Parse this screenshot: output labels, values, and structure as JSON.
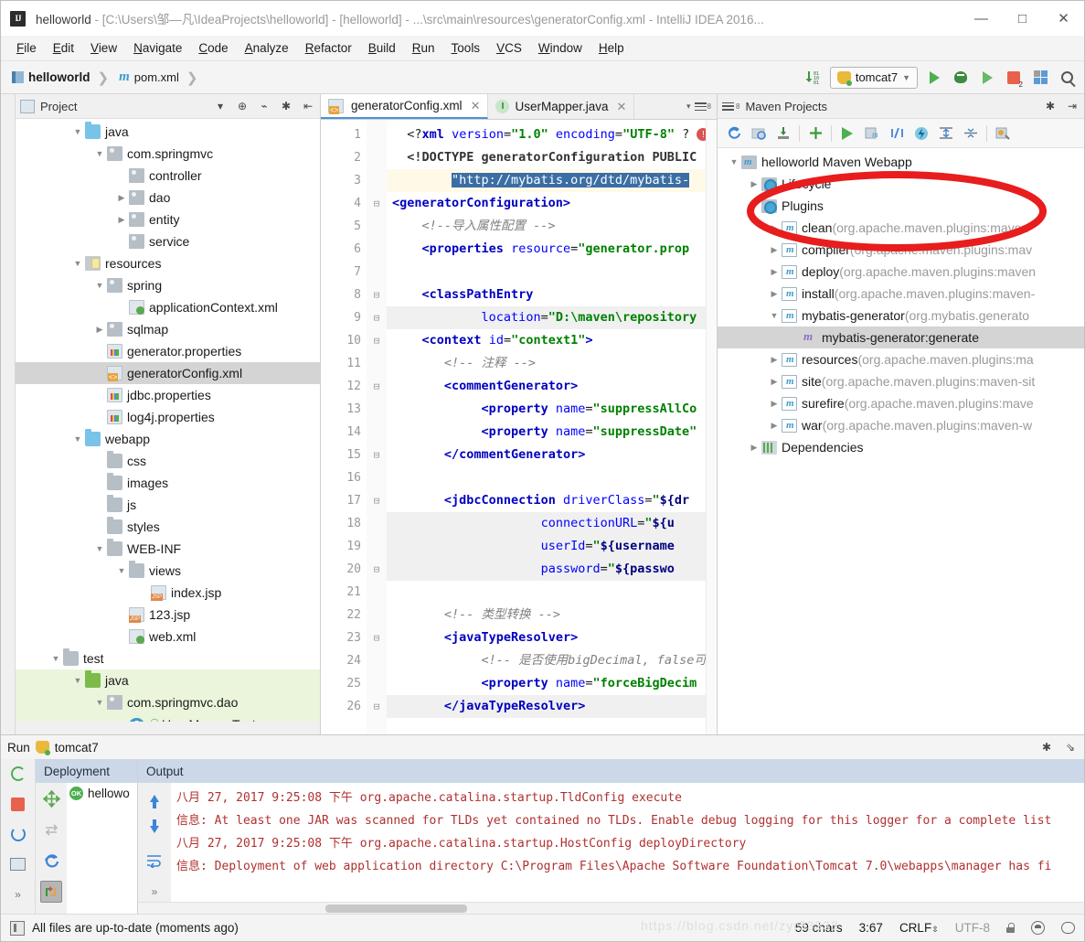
{
  "window": {
    "title_project": "helloworld",
    "title_rest": " - [C:\\Users\\邹—凡\\IdeaProjects\\helloworld] - [helloworld] - ...\\src\\main\\resources\\generatorConfig.xml - IntelliJ IDEA 2016...",
    "minimize": "—",
    "maximize": "□",
    "close": "✕"
  },
  "menubar": {
    "items": [
      "File",
      "Edit",
      "View",
      "Navigate",
      "Code",
      "Analyze",
      "Refactor",
      "Build",
      "Run",
      "Tools",
      "VCS",
      "Window",
      "Help"
    ]
  },
  "navbar": {
    "breadcrumb": [
      "helloworld",
      "pom.xml"
    ],
    "run_config": "tomcat7",
    "stop_badge": "2"
  },
  "project_panel": {
    "title": "Project",
    "tree": [
      {
        "label": "java",
        "indent": 2,
        "arrow": "down",
        "icon": "folder-source-blue"
      },
      {
        "label": "com.springmvc",
        "indent": 3,
        "arrow": "down",
        "icon": "package"
      },
      {
        "label": "controller",
        "indent": 4,
        "arrow": "none",
        "icon": "package"
      },
      {
        "label": "dao",
        "indent": 4,
        "arrow": "right",
        "icon": "package"
      },
      {
        "label": "entity",
        "indent": 4,
        "arrow": "right",
        "icon": "package"
      },
      {
        "label": "service",
        "indent": 4,
        "arrow": "none",
        "icon": "package"
      },
      {
        "label": "resources",
        "indent": 2,
        "arrow": "down",
        "icon": "folder-resource"
      },
      {
        "label": "spring",
        "indent": 3,
        "arrow": "down",
        "icon": "package"
      },
      {
        "label": "applicationContext.xml",
        "indent": 4,
        "arrow": "none",
        "icon": "xml-spring"
      },
      {
        "label": "sqlmap",
        "indent": 3,
        "arrow": "right",
        "icon": "package"
      },
      {
        "label": "generator.properties",
        "indent": 3,
        "arrow": "none",
        "icon": "properties"
      },
      {
        "label": "generatorConfig.xml",
        "indent": 3,
        "arrow": "none",
        "icon": "xml",
        "selected": true
      },
      {
        "label": "jdbc.properties",
        "indent": 3,
        "arrow": "none",
        "icon": "properties"
      },
      {
        "label": "log4j.properties",
        "indent": 3,
        "arrow": "none",
        "icon": "properties"
      },
      {
        "label": "webapp",
        "indent": 2,
        "arrow": "down",
        "icon": "folder-webapp"
      },
      {
        "label": "css",
        "indent": 3,
        "arrow": "none",
        "icon": "folder-gray"
      },
      {
        "label": "images",
        "indent": 3,
        "arrow": "none",
        "icon": "folder-gray"
      },
      {
        "label": "js",
        "indent": 3,
        "arrow": "none",
        "icon": "folder-gray"
      },
      {
        "label": "styles",
        "indent": 3,
        "arrow": "none",
        "icon": "folder-gray"
      },
      {
        "label": "WEB-INF",
        "indent": 3,
        "arrow": "down",
        "icon": "folder-gray"
      },
      {
        "label": "views",
        "indent": 4,
        "arrow": "down",
        "icon": "folder-gray"
      },
      {
        "label": "index.jsp",
        "indent": 5,
        "arrow": "none",
        "icon": "jsp"
      },
      {
        "label": "123.jsp",
        "indent": 4,
        "arrow": "none",
        "icon": "jsp"
      },
      {
        "label": "web.xml",
        "indent": 4,
        "arrow": "none",
        "icon": "xml-spring"
      },
      {
        "label": "test",
        "indent": 1,
        "arrow": "down",
        "icon": "folder-gray"
      },
      {
        "label": "java",
        "indent": 2,
        "arrow": "down",
        "icon": "folder-test-green",
        "test": true
      },
      {
        "label": "com.springmvc.dao",
        "indent": 3,
        "arrow": "down",
        "icon": "package",
        "test": true
      },
      {
        "label": "UserMapperTest",
        "indent": 4,
        "arrow": "none",
        "icon": "class",
        "test": true,
        "lock": true
      }
    ]
  },
  "editor": {
    "tabs": [
      {
        "label": "generatorConfig.xml",
        "icon": "xml-file-icon",
        "active": true,
        "close": "✕"
      },
      {
        "label": "UserMapper.java",
        "icon": "java-interface-icon",
        "active": false,
        "close": "✕"
      }
    ],
    "line_count_badge": "8",
    "lines": [
      {
        "n": 1,
        "fold": "",
        "state": "",
        "html": "  <span class='k-plain'>&lt;?</span><span class='k-tag'>xml</span> <span class='k-attr'>version</span>=<span class='k-str'>\"1.0\"</span> <span class='k-attr'>encoding</span>=<span class='k-str'>\"UTF-8\"</span> <span class='k-plain'>?</span>"
      },
      {
        "n": 2,
        "fold": "",
        "state": "",
        "html": "  <span class='k-dtd'>&lt;!DOCTYPE generatorConfiguration PUBLIC</span>"
      },
      {
        "n": 3,
        "fold": "",
        "state": "cur",
        "html": "        <span class='sel-blue'>\"http://mybatis.org/dtd/mybatis-</span>"
      },
      {
        "n": 4,
        "fold": "-",
        "state": "",
        "html": "<span class='k-tag'>&lt;generatorConfiguration&gt;</span>"
      },
      {
        "n": 5,
        "fold": "",
        "state": "",
        "html": "    <span class='k-cmt'>&lt;!--导入属性配置 --&gt;</span>"
      },
      {
        "n": 6,
        "fold": "",
        "state": "",
        "html": "    <span class='k-tag'>&lt;properties</span> <span class='k-attr'>resource</span>=<span class='k-str'>\"generator.prop</span>"
      },
      {
        "n": 7,
        "fold": "",
        "state": "",
        "html": ""
      },
      {
        "n": 8,
        "fold": "-",
        "state": "",
        "html": "    <span class='k-tag'>&lt;classPathEntry</span>"
      },
      {
        "n": 9,
        "fold": "-",
        "state": "hl",
        "html": "            <span class='k-attr'>location</span>=<span class='k-str'>\"D:\\maven\\repository</span>"
      },
      {
        "n": 10,
        "fold": "-",
        "state": "",
        "html": "    <span class='k-tag'>&lt;context</span> <span class='k-attr'>id</span>=<span class='k-str'>\"context1\"</span><span class='k-tag'>&gt;</span>"
      },
      {
        "n": 11,
        "fold": "",
        "state": "",
        "html": "       <span class='k-cmt'>&lt;!-- 注释 --&gt;</span>"
      },
      {
        "n": 12,
        "fold": "-",
        "state": "",
        "html": "       <span class='k-tag'>&lt;commentGenerator&gt;</span>"
      },
      {
        "n": 13,
        "fold": "",
        "state": "",
        "html": "            <span class='k-tag'>&lt;property</span> <span class='k-attr'>name</span>=<span class='k-str'>\"suppressAllCo</span>"
      },
      {
        "n": 14,
        "fold": "",
        "state": "",
        "html": "            <span class='k-tag'>&lt;property</span> <span class='k-attr'>name</span>=<span class='k-str'>\"suppressDate\"</span>"
      },
      {
        "n": 15,
        "fold": "-",
        "state": "",
        "html": "       <span class='k-tag'>&lt;/commentGenerator&gt;</span>"
      },
      {
        "n": 16,
        "fold": "",
        "state": "",
        "html": ""
      },
      {
        "n": 17,
        "fold": "-",
        "state": "",
        "html": "       <span class='k-tag'>&lt;jdbcConnection</span> <span class='k-attr'>driverClass</span>=<span class='k-str'>\"</span><span class='k-var'>${dr</span>"
      },
      {
        "n": 18,
        "fold": "",
        "state": "hl",
        "html": "                    <span class='k-attr'>connectionURL</span>=<span class='k-str'>\"</span><span class='k-var'>${u</span>"
      },
      {
        "n": 19,
        "fold": "",
        "state": "hl",
        "html": "                    <span class='k-attr'>userId</span>=<span class='k-str'>\"</span><span class='k-var'>${username</span>"
      },
      {
        "n": 20,
        "fold": "-",
        "state": "hl",
        "html": "                    <span class='k-attr'>password</span>=<span class='k-str'>\"</span><span class='k-var'>${passwo</span>"
      },
      {
        "n": 21,
        "fold": "",
        "state": "",
        "html": ""
      },
      {
        "n": 22,
        "fold": "",
        "state": "",
        "html": "       <span class='k-cmt'>&lt;!-- 类型转换 --&gt;</span>"
      },
      {
        "n": 23,
        "fold": "-",
        "state": "",
        "html": "       <span class='k-tag'>&lt;javaTypeResolver&gt;</span>"
      },
      {
        "n": 24,
        "fold": "",
        "state": "",
        "html": "            <span class='k-cmt'>&lt;!-- 是否使用bigDecimal, false可</span>"
      },
      {
        "n": 25,
        "fold": "",
        "state": "",
        "html": "            <span class='k-tag'>&lt;property</span> <span class='k-attr'>name</span>=<span class='k-str'>\"forceBigDecim</span>"
      },
      {
        "n": 26,
        "fold": "-",
        "state": "hl",
        "html": "       <span class='k-tag'>&lt;/javaTypeResolver&gt;</span>"
      }
    ]
  },
  "maven_panel": {
    "title": "Maven Projects",
    "tree": [
      {
        "label": "helloworld Maven Webapp",
        "suffix": "",
        "indent": 0,
        "arrow": "down",
        "icon": "maven-module"
      },
      {
        "label": "Lifecycle",
        "suffix": "",
        "indent": 1,
        "arrow": "right",
        "icon": "maven-phase-group"
      },
      {
        "label": "Plugins",
        "suffix": "",
        "indent": 1,
        "arrow": "down",
        "icon": "maven-phase-group"
      },
      {
        "label": "clean",
        "suffix": " (org.apache.maven.plugins:maven-",
        "indent": 2,
        "arrow": "right",
        "icon": "maven-plugin"
      },
      {
        "label": "compiler",
        "suffix": " (org.apache.maven.plugins:mav",
        "indent": 2,
        "arrow": "right",
        "icon": "maven-plugin"
      },
      {
        "label": "deploy",
        "suffix": " (org.apache.maven.plugins:maven",
        "indent": 2,
        "arrow": "right",
        "icon": "maven-plugin"
      },
      {
        "label": "install",
        "suffix": " (org.apache.maven.plugins:maven-",
        "indent": 2,
        "arrow": "right",
        "icon": "maven-plugin"
      },
      {
        "label": "mybatis-generator",
        "suffix": " (org.mybatis.generato",
        "indent": 2,
        "arrow": "down",
        "icon": "maven-plugin"
      },
      {
        "label": "mybatis-generator:generate",
        "suffix": "",
        "indent": 3,
        "arrow": "none",
        "icon": "maven-goal",
        "selected": true
      },
      {
        "label": "resources",
        "suffix": " (org.apache.maven.plugins:ma",
        "indent": 2,
        "arrow": "right",
        "icon": "maven-plugin"
      },
      {
        "label": "site",
        "suffix": " (org.apache.maven.plugins:maven-sit",
        "indent": 2,
        "arrow": "right",
        "icon": "maven-plugin"
      },
      {
        "label": "surefire",
        "suffix": " (org.apache.maven.plugins:mave",
        "indent": 2,
        "arrow": "right",
        "icon": "maven-plugin"
      },
      {
        "label": "war",
        "suffix": " (org.apache.maven.plugins:maven-w",
        "indent": 2,
        "arrow": "right",
        "icon": "maven-plugin"
      },
      {
        "label": "Dependencies",
        "suffix": "",
        "indent": 1,
        "arrow": "right",
        "icon": "maven-dependencies"
      }
    ],
    "annotation_color": "#e81d1d"
  },
  "run_panel": {
    "title": "Run",
    "config_name": "tomcat7",
    "columns": {
      "deployment": "Deployment",
      "output": "Output"
    },
    "deployment_item": "hellowo",
    "deployment_badge": "OK",
    "console_lines": [
      "八月 27, 2017 9:25:08 下午 org.apache.catalina.startup.TldConfig execute",
      "信息: At least one JAR was scanned for TLDs yet contained no TLDs. Enable debug logging for this logger for a complete list",
      "八月 27, 2017 9:25:08 下午 org.apache.catalina.startup.HostConfig deployDirectory",
      "信息: Deployment of web application directory C:\\Program Files\\Apache Software Foundation\\Tomcat 7.0\\webapps\\manager has fi"
    ],
    "more": "»"
  },
  "statusbar": {
    "message": "All files are up-to-date (moments ago)",
    "chars": "59 chars",
    "caret": "3:67",
    "line_sep": "CRLF",
    "encoding": "UTF-8",
    "watermark": "https://blog.csdn.net/zyr33333"
  }
}
